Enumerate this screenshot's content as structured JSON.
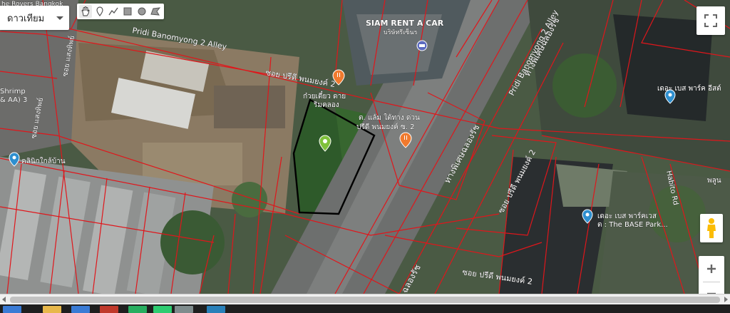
{
  "map_type": {
    "label": "ดาวเทียม"
  },
  "draw_tools": [
    {
      "name": "pan-hand-icon"
    },
    {
      "name": "marker-tool-icon"
    },
    {
      "name": "polyline-tool-icon"
    },
    {
      "name": "rectangle-tool-icon"
    },
    {
      "name": "circle-tool-icon"
    },
    {
      "name": "polygon-tool-icon"
    }
  ],
  "labels": {
    "top_left": "he Rovers Bangkok",
    "alley_top": "Pridi Banomyong 2 Alley",
    "alley_right": "Pridi Banomyong 2 Alley",
    "soi_th_top": "ซอย ปรีดี พนมยงค์ 2",
    "soi_th_center": "ซอย ปรีดี พนมยงค์ 2",
    "soi_th_bottom": "ซอย ปรีดี พนมยงค์ 2",
    "siam_rent": "SIAM RENT A CAR",
    "siam_rent_th": "บริษัทรีเซ็นร",
    "noodle_1": "ก๋วยเตี๋ยว ดาย",
    "noodle_2": "ริมคลอง",
    "stall_1": "ต. แล้ม ใต้ทาง ด่วน",
    "stall_2": "ปรีดี พนมยงค์ ซ. 2",
    "expressway_top": "ทางพิเศษฉลองรัช",
    "expressway_mid": "ทางพิเศษฉลองรัช",
    "expressway_bot": "ฉลองรัช",
    "the_base_1": "เดอะ เบส พาร์ค อีสต์",
    "the_base_2_th": "เดอะ เบส พาร์คเวส",
    "the_base_2_en": "ต : The BASE Park...",
    "clinic": "คลินิกใกล้บ้าน",
    "shrimp_1": "Shrimp",
    "shrimp_2": "& AA) 3",
    "soi_saeng": "ซอย แสงทิพย์",
    "soi_saeng_2": "ซอย แสงทิพย์",
    "habito": "Habito Rd",
    "palm": "พลูน"
  },
  "colors": {
    "parcel_lines": "#e0161b",
    "selected_parcel": "#000000",
    "pin_green": "#7fc13a",
    "pin_blue": "#2e8fcf",
    "pin_orange": "#f07a2e"
  }
}
